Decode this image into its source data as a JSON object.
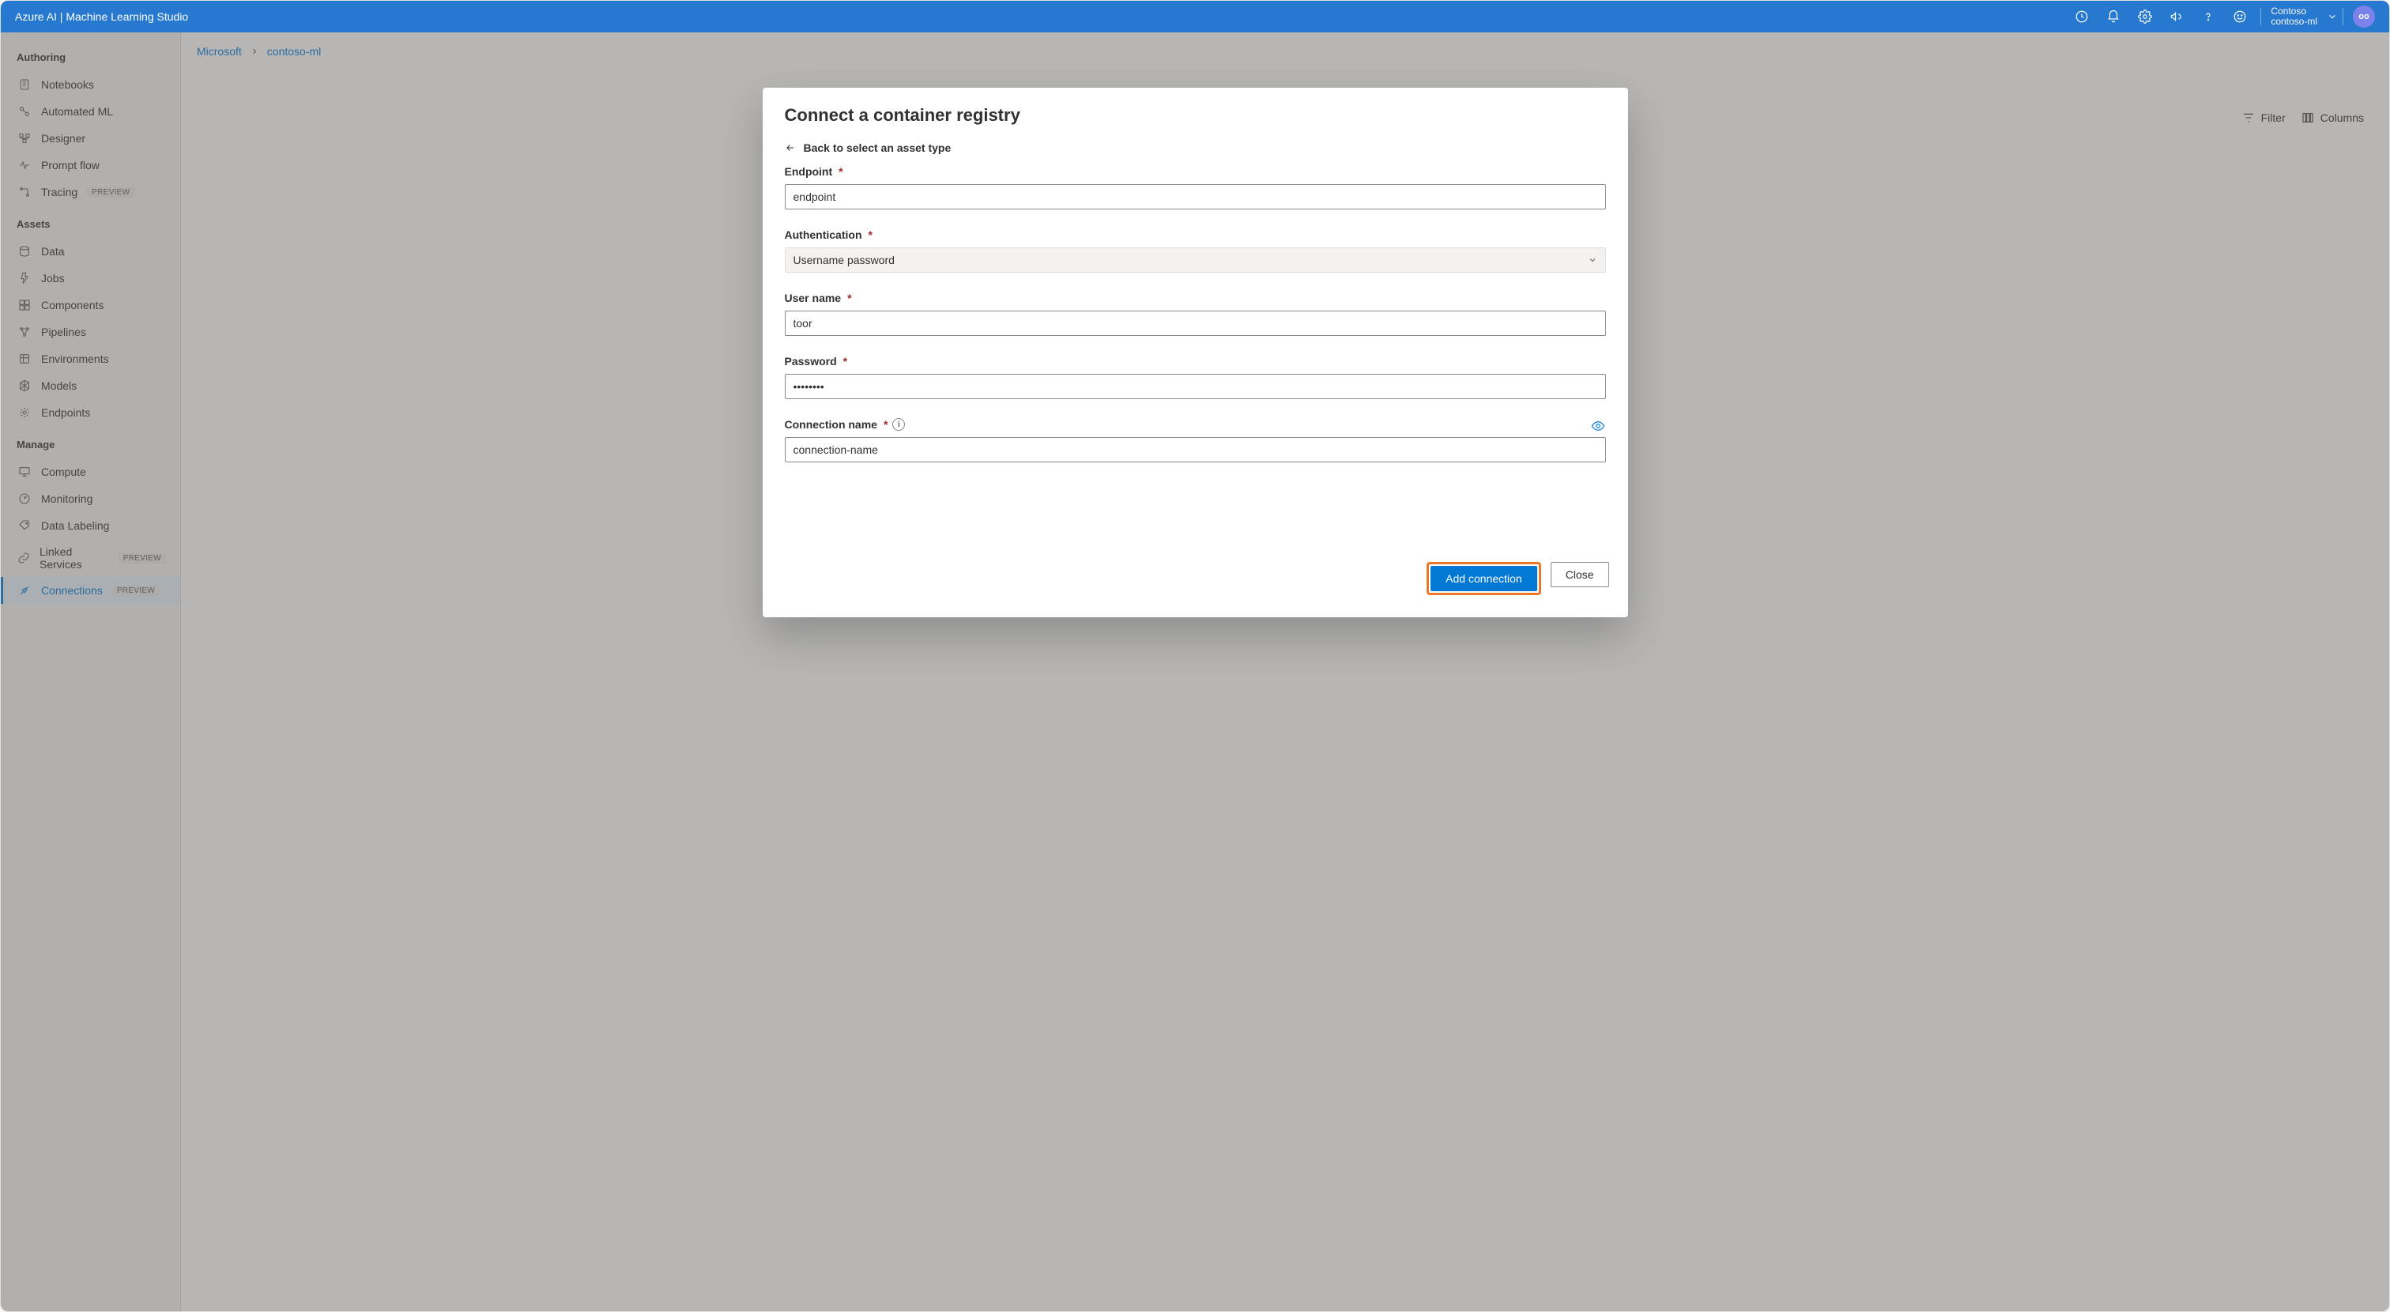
{
  "topbar": {
    "title": "Azure AI | Machine Learning Studio",
    "directory": "Contoso",
    "workspace": "contoso-ml",
    "avatar_initials": "oo"
  },
  "breadcrumb": {
    "root": "Microsoft",
    "current": "contoso-ml"
  },
  "toolbar": {
    "filter_label": "Filter",
    "columns_label": "Columns"
  },
  "sidebar": {
    "sections": {
      "authoring": {
        "title": "Authoring"
      },
      "assets": {
        "title": "Assets"
      },
      "manage": {
        "title": "Manage"
      }
    },
    "items": {
      "notebooks": "Notebooks",
      "automated_ml": "Automated ML",
      "designer": "Designer",
      "prompt_flow": "Prompt flow",
      "tracing": "Tracing",
      "data": "Data",
      "jobs": "Jobs",
      "components": "Components",
      "pipelines": "Pipelines",
      "environments": "Environments",
      "models": "Models",
      "endpoints": "Endpoints",
      "compute": "Compute",
      "monitoring": "Monitoring",
      "data_labeling": "Data Labeling",
      "linked_services": "Linked Services",
      "connections": "Connections"
    },
    "preview_badge": "PREVIEW"
  },
  "modal": {
    "title": "Connect a container registry",
    "back_label": "Back to select an asset type",
    "fields": {
      "endpoint": {
        "label": "Endpoint",
        "value": "endpoint"
      },
      "authentication": {
        "label": "Authentication",
        "value": "Username password"
      },
      "username": {
        "label": "User name",
        "value": "toor"
      },
      "password": {
        "label": "Password",
        "value": "••••••••"
      },
      "connection_name": {
        "label": "Connection name",
        "value": "connection-name"
      }
    },
    "buttons": {
      "add": "Add connection",
      "close": "Close"
    }
  }
}
